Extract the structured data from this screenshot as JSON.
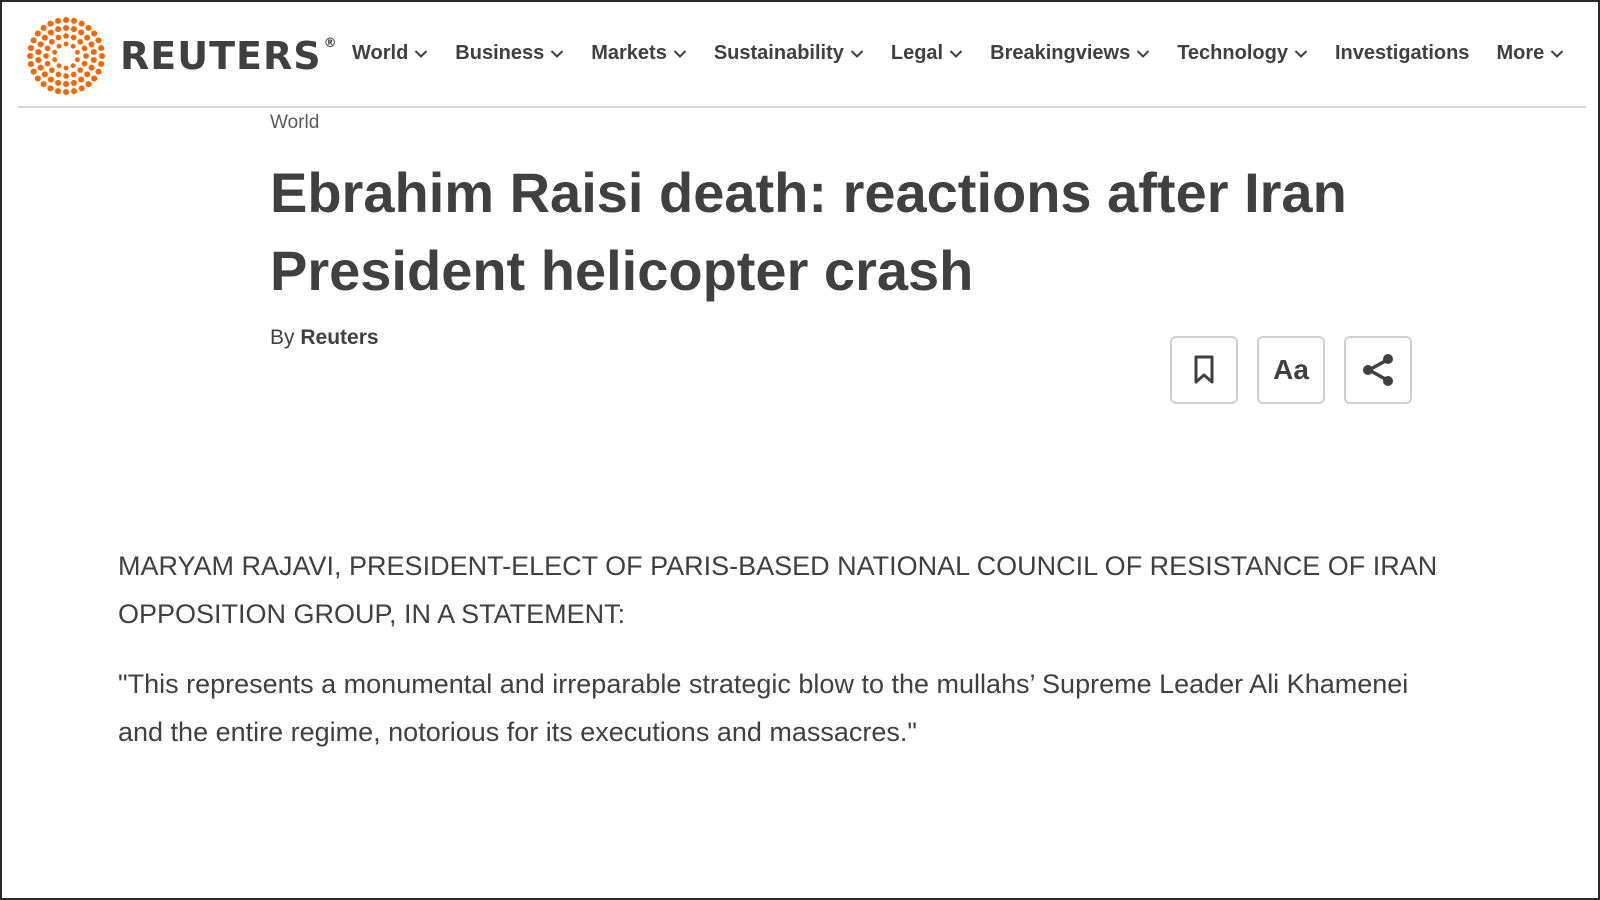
{
  "header": {
    "logo_text": "REUTERS",
    "logo_reg": "®",
    "brand_color": "#fa6400",
    "nav": [
      {
        "label": "World",
        "dropdown": true
      },
      {
        "label": "Business",
        "dropdown": true
      },
      {
        "label": "Markets",
        "dropdown": true
      },
      {
        "label": "Sustainability",
        "dropdown": true
      },
      {
        "label": "Legal",
        "dropdown": true
      },
      {
        "label": "Breakingviews",
        "dropdown": true
      },
      {
        "label": "Technology",
        "dropdown": true
      },
      {
        "label": "Investigations",
        "dropdown": false
      },
      {
        "label": "More",
        "dropdown": true
      }
    ]
  },
  "article": {
    "section": "World",
    "headline": "Ebrahim Raisi death: reactions after Iran President helicopter crash",
    "byline_prefix": "By",
    "byline_author": "Reuters",
    "tools": {
      "bookmark_icon": "bookmark-icon",
      "text_size_label": "Aa",
      "share_icon": "share-icon"
    },
    "speaker": "MARYAM RAJAVI, PRESIDENT-ELECT OF PARIS-BASED NATIONAL COUNCIL OF RESISTANCE OF IRAN OPPOSITION GROUP, IN A STATEMENT:",
    "quote": "\"This represents a monumental and irreparable strategic blow to the mullahs’ Supreme Leader Ali Khamenei and the entire regime, notorious for its executions and massacres.\""
  }
}
